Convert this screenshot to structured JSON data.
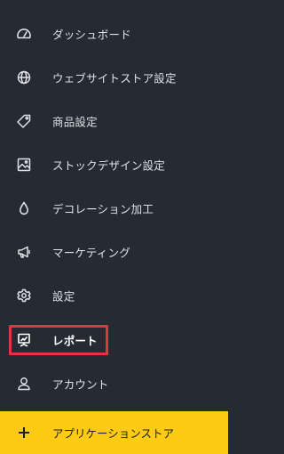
{
  "sidebar": {
    "items": [
      {
        "label": "ダッシュボード",
        "icon": "dashboard-gauge-icon"
      },
      {
        "label": "ウェブサイトストア設定",
        "icon": "globe-icon"
      },
      {
        "label": "商品設定",
        "icon": "tag-icon"
      },
      {
        "label": "ストックデザイン設定",
        "icon": "image-icon"
      },
      {
        "label": "デコレーション加工",
        "icon": "droplet-icon"
      },
      {
        "label": "マーケティング",
        "icon": "megaphone-icon"
      },
      {
        "label": "設定",
        "icon": "gear-icon"
      },
      {
        "label": "レポート",
        "icon": "report-icon",
        "selected": true
      },
      {
        "label": "アカウント",
        "icon": "user-icon"
      }
    ],
    "app_store": {
      "label": "アプリケーションストア",
      "icon": "plus-icon"
    }
  },
  "colors": {
    "background": "#252a33",
    "text": "#dfe2e6",
    "highlight_border": "#e5333f",
    "store_button": "#fdcb16"
  }
}
